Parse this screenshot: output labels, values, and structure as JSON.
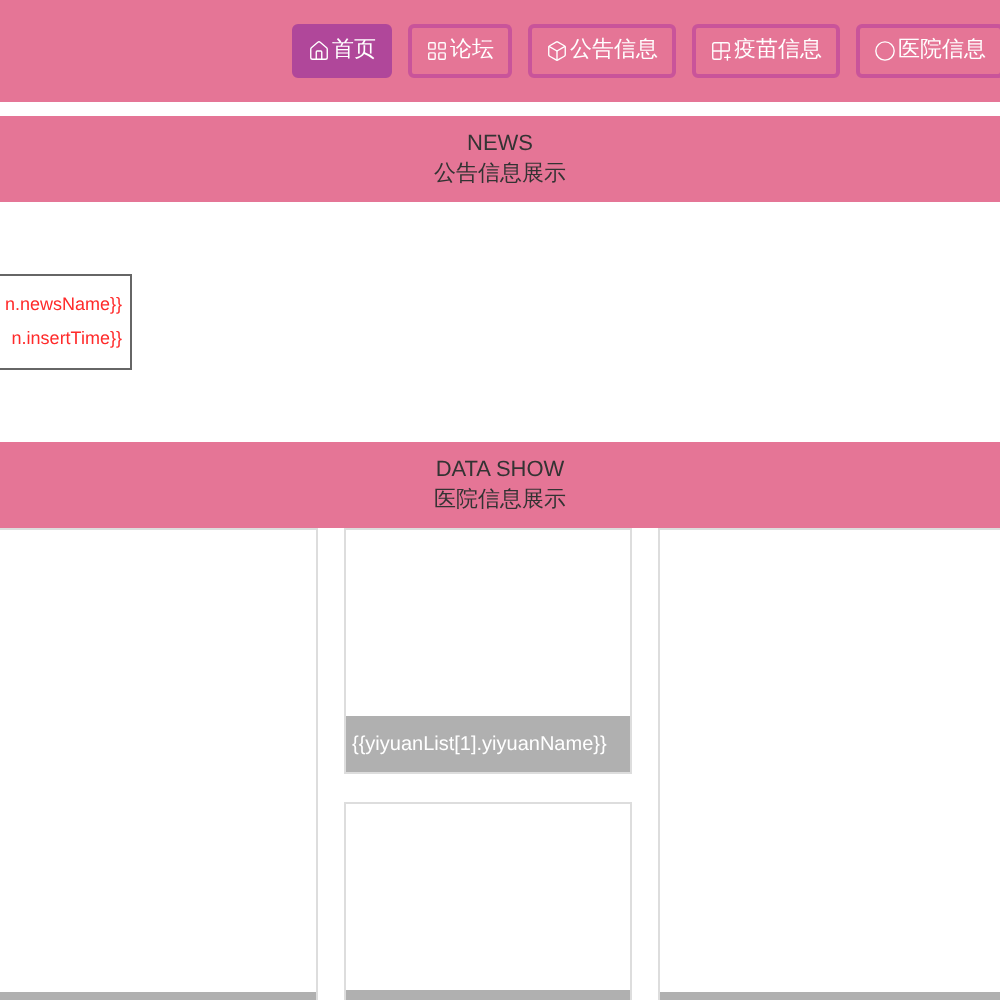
{
  "nav": [
    {
      "label": "首页",
      "kind": "home",
      "selected": true
    },
    {
      "label": "论坛",
      "kind": "forum",
      "selected": false
    },
    {
      "label": "公告信息",
      "kind": "notice",
      "selected": false
    },
    {
      "label": "疫苗信息",
      "kind": "vaccine",
      "selected": false
    },
    {
      "label": "医院信息",
      "kind": "hospital",
      "selected": false
    }
  ],
  "news_section": {
    "title": "NEWS",
    "subtitle": "公告信息展示"
  },
  "news_item": {
    "name": "n.newsName}}",
    "time": "n.insertTime}}"
  },
  "data_section": {
    "title": "DATA SHOW",
    "subtitle": "医院信息展示"
  },
  "hospital_card": {
    "caption": "{{yiyuanList[1].yiyuanName}}"
  }
}
